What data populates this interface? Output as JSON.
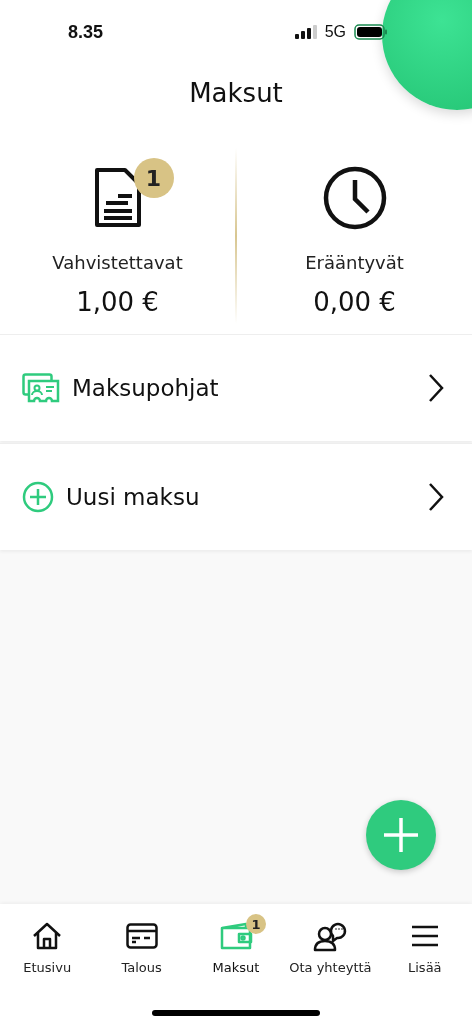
{
  "status_bar": {
    "time": "8.35",
    "network": "5G"
  },
  "title": "Maksut",
  "summary": [
    {
      "label": "Vahvistettavat",
      "amount": "1,00 €",
      "badge": "1"
    },
    {
      "label": "Erääntyvät",
      "amount": "0,00 €"
    }
  ],
  "rows": [
    {
      "label": "Maksupohjat"
    },
    {
      "label": "Uusi maksu"
    }
  ],
  "tabs": [
    {
      "label": "Etusivu",
      "selected": false
    },
    {
      "label": "Talous",
      "selected": false
    },
    {
      "label": "Maksut",
      "selected": true,
      "badge": "1"
    },
    {
      "label": "Ota yhteyttä",
      "selected": false
    },
    {
      "label": "Lisää",
      "selected": false
    }
  ]
}
